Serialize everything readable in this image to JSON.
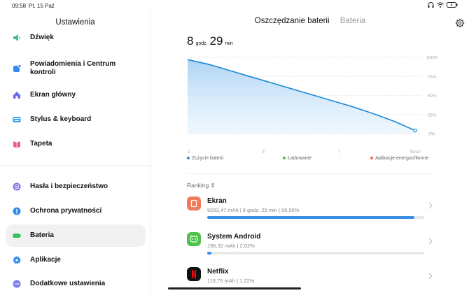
{
  "status_bar": {
    "time": "09:58",
    "date": "Pt, 15 Paź",
    "battery_level": "8"
  },
  "sidebar": {
    "title": "Ustawienia",
    "items": [
      {
        "label": "Dźwięk",
        "icon": "speaker-icon",
        "color": "#3bc48a"
      },
      {
        "label": "Powiadomienia i Centrum kontroli",
        "icon": "notification-icon",
        "color": "#2f8cf0"
      },
      {
        "label": "Ekran główny",
        "icon": "home-icon",
        "color": "#6a6df0"
      },
      {
        "label": "Stylus & keyboard",
        "icon": "keyboard-icon",
        "color": "#2fa8f0"
      },
      {
        "label": "Tapeta",
        "icon": "wallpaper-icon",
        "color": "#f05a8a"
      },
      {
        "label": "Hasła i bezpieczeństwo",
        "icon": "fingerprint-icon",
        "color": "#7a6df0"
      },
      {
        "label": "Ochrona prywatności",
        "icon": "privacy-icon",
        "color": "#2f8cf0"
      },
      {
        "label": "Bateria",
        "icon": "battery-icon",
        "color": "#35c25a"
      },
      {
        "label": "Aplikacje",
        "icon": "gear-icon",
        "color": "#2f8cf0"
      },
      {
        "label": "Dodatkowe ustawienia",
        "icon": "more-icon",
        "color": "#7a7df0"
      }
    ]
  },
  "tabs": [
    {
      "label": "Oszczędzanie baterii",
      "active": true
    },
    {
      "label": "Bateria",
      "active": false
    }
  ],
  "remaining": {
    "hours": "8",
    "hours_unit": "godz.",
    "minutes": "29",
    "minutes_unit": "min"
  },
  "chart_data": {
    "type": "area",
    "x_ticks": [
      "1",
      "4",
      "7",
      "Teraz"
    ],
    "y_ticks": [
      "100%",
      "75%",
      "50%",
      "25%",
      "0%"
    ],
    "ylim": [
      0,
      100
    ],
    "series": [
      {
        "values": [
          97,
          91,
          83,
          75,
          67,
          59,
          51,
          43,
          35,
          26,
          16,
          4
        ]
      }
    ],
    "color": "#1a8ad4"
  },
  "legend": [
    {
      "label": "Zużycie baterii",
      "color": "#2f8cf0"
    },
    {
      "label": "Ładowanie",
      "color": "#35c25a"
    },
    {
      "label": "Aplikacje energochłonne",
      "color": "#f06a3a"
    }
  ],
  "ranking_label": "Ranking ⇕",
  "apps": [
    {
      "name": "Ekran",
      "detail": "9283,47 mAh | 8 godz. 29 min  | 95,56%",
      "percent": 95.56,
      "icon": "screen-icon",
      "color": "#f07a5a"
    },
    {
      "name": "System Android",
      "detail": "196,32 mAh | 2,02%",
      "percent": 2.02,
      "icon": "android-icon",
      "color": "#4ec24a"
    },
    {
      "name": "Netflix",
      "detail": "118,75 mAh | 1,22%",
      "percent": 1.22,
      "icon": "netflix-icon",
      "color": "#111111"
    }
  ]
}
